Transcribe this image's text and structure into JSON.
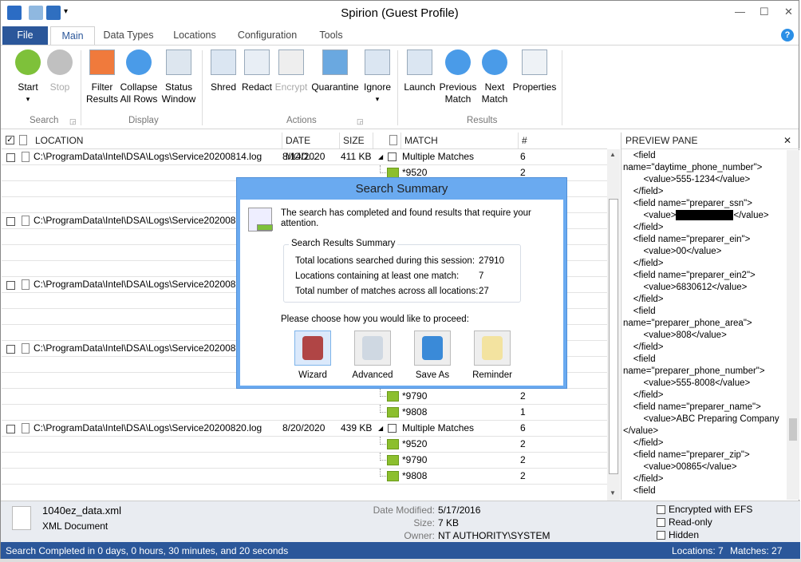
{
  "window": {
    "title": "Spirion  (Guest Profile)"
  },
  "menu_tabs": [
    {
      "label": "File"
    },
    {
      "label": "Main"
    },
    {
      "label": "Data Types"
    },
    {
      "label": "Locations"
    },
    {
      "label": "Configuration"
    },
    {
      "label": "Tools"
    }
  ],
  "help_label": "?",
  "ribbon": {
    "buttons": [
      {
        "label": "Start",
        "sub": "▾"
      },
      {
        "label": "Stop"
      },
      {
        "label": "Filter\nResults"
      },
      {
        "label": "Collapse\nAll Rows"
      },
      {
        "label": "Status\nWindow"
      },
      {
        "label": "Shred"
      },
      {
        "label": "Redact"
      },
      {
        "label": "Encrypt"
      },
      {
        "label": "Quarantine"
      },
      {
        "label": "Ignore",
        "sub": "▾"
      },
      {
        "label": "Launch"
      },
      {
        "label": "Previous\nMatch"
      },
      {
        "label": "Next\nMatch"
      },
      {
        "label": "Properties"
      }
    ],
    "groups": [
      "Search",
      "Display",
      "Actions",
      "Results"
    ]
  },
  "columns": {
    "location": "LOCATION",
    "date": "DATE MOD...",
    "size": "SIZE",
    "match": "MATCH",
    "count": "#"
  },
  "rows": [
    {
      "type": "file",
      "location": "C:\\ProgramData\\Intel\\DSA\\Logs\\Service20200814.log",
      "date": "8/14/2020",
      "size": "411 KB",
      "match": "Multiple Matches",
      "count": "6"
    },
    {
      "type": "child",
      "match": "*9520",
      "count": "2"
    },
    {
      "type": "blank"
    },
    {
      "type": "blank"
    },
    {
      "type": "file",
      "location": "C:\\ProgramData\\Intel\\DSA\\Logs\\Service2020081"
    },
    {
      "type": "blank"
    },
    {
      "type": "blank"
    },
    {
      "type": "blank"
    },
    {
      "type": "file",
      "location": "C:\\ProgramData\\Intel\\DSA\\Logs\\Service2020081"
    },
    {
      "type": "blank"
    },
    {
      "type": "blank"
    },
    {
      "type": "blank"
    },
    {
      "type": "file",
      "location": "C:\\ProgramData\\Intel\\DSA\\Logs\\Service2020081"
    },
    {
      "type": "blank"
    },
    {
      "type": "blank"
    },
    {
      "type": "child",
      "match": "*9790",
      "count": "2"
    },
    {
      "type": "child",
      "match": "*9808",
      "count": "1"
    },
    {
      "type": "file",
      "location": "C:\\ProgramData\\Intel\\DSA\\Logs\\Service20200820.log",
      "date": "8/20/2020",
      "size": "439 KB",
      "match": "Multiple Matches",
      "count": "6"
    },
    {
      "type": "child",
      "match": "*9520",
      "count": "2"
    },
    {
      "type": "child",
      "match": "*9790",
      "count": "2"
    },
    {
      "type": "child",
      "match": "*9808",
      "count": "2"
    }
  ],
  "preview": {
    "title": "PREVIEW PANE",
    "lines": [
      "    <field",
      "name=\"daytime_phone_number\">",
      "        <value>555-1234</value>",
      "    </field>",
      "    <field name=\"preparer_ssn\">",
      "        <value>[REDACTED]</value>",
      "    </field>",
      "    <field name=\"preparer_ein\">",
      "        <value>00</value>",
      "    </field>",
      "    <field name=\"preparer_ein2\">",
      "        <value>6830612</value>",
      "    </field>",
      "    <field",
      "name=\"preparer_phone_area\">",
      "        <value>808</value>",
      "    </field>",
      "    <field",
      "name=\"preparer_phone_number\">",
      "        <value>555-8008</value>",
      "    </field>",
      "    <field name=\"preparer_name\">",
      "        <value>ABC Preparing Company",
      "</value>",
      "    </field>",
      "    <field name=\"preparer_zip\">",
      "        <value>00865</value>",
      "    </field>",
      "    <field"
    ]
  },
  "details": {
    "file_name": "1040ez_data.xml",
    "file_type": "XML Document",
    "date_label": "Date Modified:",
    "date": "5/17/2016",
    "size_label": "Size:",
    "size": "7 KB",
    "owner_label": "Owner:",
    "owner": "NT AUTHORITY\\SYSTEM",
    "attrs": [
      {
        "label": "Encrypted with EFS",
        "checked": false
      },
      {
        "label": "Read-only",
        "checked": false
      },
      {
        "label": "Hidden",
        "checked": false
      }
    ]
  },
  "status": {
    "message": "Search Completed in 0 days, 0 hours, 30 minutes, and 20 seconds",
    "locations": "Locations: 7",
    "matches": "Matches: 27"
  },
  "dialog": {
    "title": "Search Summary",
    "message": "The search has completed and found results that require your attention.",
    "summary_title": "Search Results Summary",
    "stats": [
      {
        "label": "Total locations searched during this session:",
        "value": "27910"
      },
      {
        "label": "Locations containing at least one match:",
        "value": "7"
      },
      {
        "label": "Total number of matches across all locations:",
        "value": "27"
      }
    ],
    "prompt": "Please choose how you would like to proceed:",
    "options": [
      {
        "label": "Wizard",
        "selected": true
      },
      {
        "label": "Advanced"
      },
      {
        "label": "Save As"
      },
      {
        "label": "Reminder"
      }
    ]
  },
  "colors": {
    "accent": "#2b579a",
    "dialog_frame": "#6aaaf0",
    "match_icon": "#8cbf2e"
  }
}
